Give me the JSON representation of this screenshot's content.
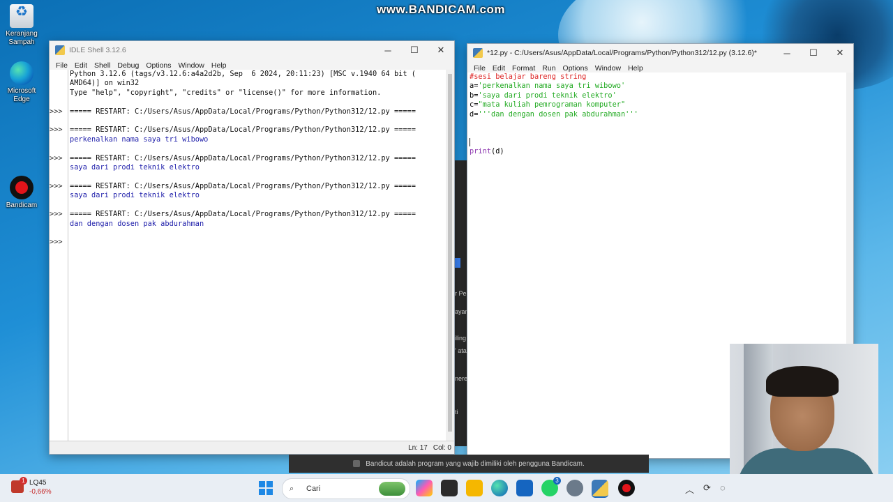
{
  "desktop": {
    "watermark": "www.BANDICAM.com",
    "icons": [
      {
        "label": "Keranjang Sampah",
        "icon": "recycle-bin-icon"
      },
      {
        "label": "Microsoft Edge",
        "icon": "edge-icon"
      },
      {
        "label": "Bandicam",
        "icon": "bandicam-icon"
      }
    ]
  },
  "shell_window": {
    "title": "IDLE Shell 3.12.6",
    "menu": [
      "File",
      "Edit",
      "Shell",
      "Debug",
      "Options",
      "Window",
      "Help"
    ],
    "prompt": ">>>",
    "lines": [
      {
        "text": "Python 3.12.6 (tags/v3.12.6:a4a2d2b, Sep  6 2024, 20:11:23) [MSC v.1940 64 bit (",
        "kind": "blk"
      },
      {
        "text": "AMD64)] on win32",
        "kind": "blk"
      },
      {
        "text": "Type \"help\", \"copyright\", \"credits\" or \"license()\" for more information.",
        "kind": "blk"
      },
      {
        "text": "===== RESTART: C:/Users/Asus/AppData/Local/Programs/Python/Python312/12.py =====",
        "kind": "blk"
      },
      {
        "text": "===== RESTART: C:/Users/Asus/AppData/Local/Programs/Python/Python312/12.py =====",
        "kind": "blk"
      },
      {
        "text": "perkenalkan nama saya tri wibowo",
        "kind": "out"
      },
      {
        "text": "===== RESTART: C:/Users/Asus/AppData/Local/Programs/Python/Python312/12.py =====",
        "kind": "blk"
      },
      {
        "text": "saya dari prodi teknik elektro",
        "kind": "out"
      },
      {
        "text": "===== RESTART: C:/Users/Asus/AppData/Local/Programs/Python/Python312/12.py =====",
        "kind": "blk"
      },
      {
        "text": "saya dari prodi teknik elektro",
        "kind": "out"
      },
      {
        "text": "===== RESTART: C:/Users/Asus/AppData/Local/Programs/Python/Python312/12.py =====",
        "kind": "blk"
      },
      {
        "text": "dan dengan dosen pak abdurahman",
        "kind": "out"
      }
    ],
    "status": {
      "line": "Ln: 17",
      "col": "Col: 0"
    }
  },
  "editor_window": {
    "title": "*12.py - C:/Users/Asus/AppData/Local/Programs/Python/Python312/12.py (3.12.6)*",
    "menu": [
      "File",
      "Edit",
      "Format",
      "Run",
      "Options",
      "Window",
      "Help"
    ],
    "code": {
      "comment": "#sesi belajar bareng string",
      "a_var": "a=",
      "a_str": "'perkenalkan nama saya tri wibowo'",
      "b_var": "b=",
      "b_str": "'saya dari prodi teknik elektro'",
      "c_var": "c=",
      "c_str": "\"mata kuliah pemrograman komputer\"",
      "d_var": "d=",
      "d_str": "'''dan dengan dosen pak abdurahman'''",
      "print_fn": "print",
      "print_args": "(d)"
    }
  },
  "background_strip": [
    "r Pe",
    "ayan",
    "iling",
    "' ata",
    "nere",
    "ti"
  ],
  "toast": {
    "text": "Bandicut adalah program yang wajib dimiliki oleh pengguna Bandicam."
  },
  "taskbar": {
    "weather": {
      "ticker": "LQ45",
      "change": "-0,66%",
      "badge": "1"
    },
    "search_placeholder": "Cari",
    "whatsapp_badge": "3"
  }
}
